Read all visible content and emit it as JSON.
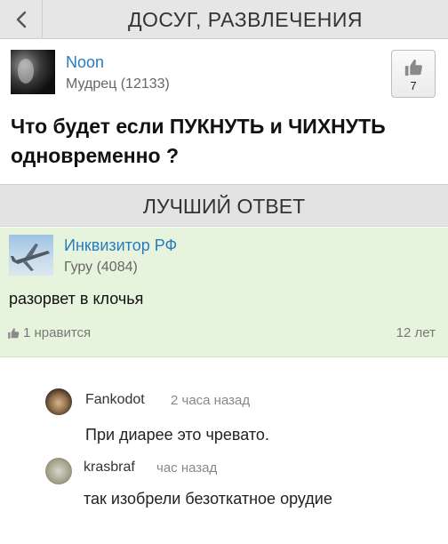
{
  "topbar": {
    "title": "ДОСУГ, РАЗВЛЕЧЕНИЯ",
    "back_icon": "chevron-left-icon"
  },
  "question": {
    "author": "Noon",
    "rank": "Мудрец (12133)",
    "likes": "7",
    "like_icon": "thumbs-up-icon",
    "text": "Что будет если ПУКНУТЬ и ЧИХНУТЬ одновременно ?"
  },
  "best_answer": {
    "header": "ЛУЧШИЙ ОТВЕТ",
    "author": "Инквизитор РФ",
    "rank": "Гуру (4084)",
    "text": "разорвет в клочья",
    "likes": "1 нравится",
    "age": "12 лет"
  },
  "comments": [
    {
      "author": "Fankodot",
      "time": "2 часа назад",
      "text": "При диарее это чревато."
    },
    {
      "author": "krasbraf",
      "time": "час назад",
      "text": "так изобрели безоткатное орудие"
    }
  ],
  "colors": {
    "link": "#2a7bbf",
    "best_answer_bg": "#e7f4dd",
    "header_bg": "#e3e3e3"
  }
}
